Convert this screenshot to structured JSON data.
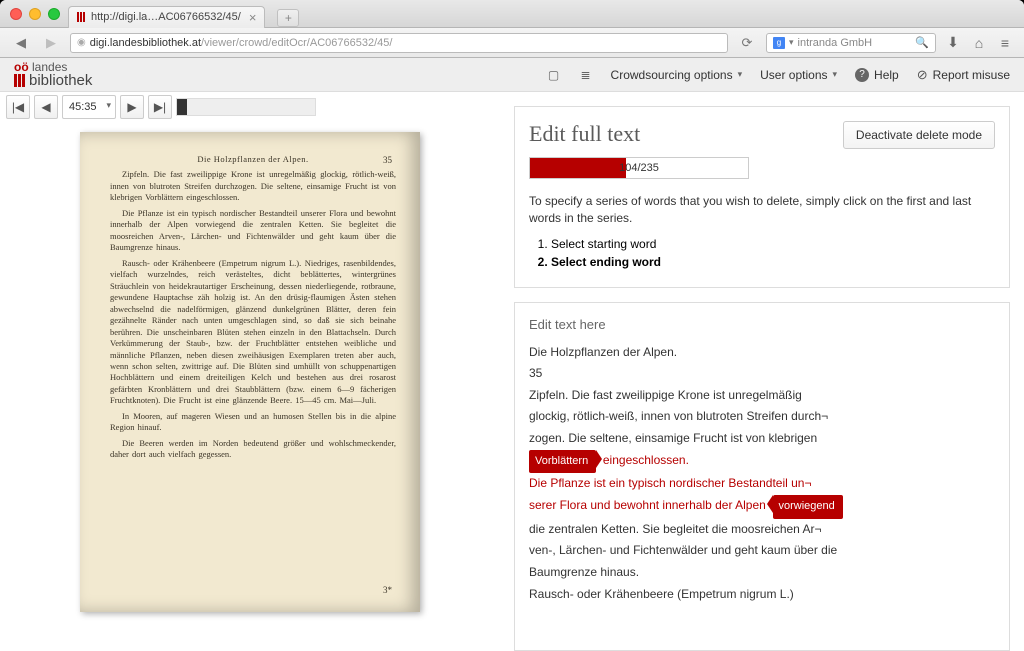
{
  "browser": {
    "tab_title": "http://digi.la…AC06766532/45/",
    "url_host": "digi.landesbibliothek.at",
    "url_path": "/viewer/crowd/editOcr/AC06766532/45/",
    "search_placeholder": "intranda GmbH"
  },
  "logo": {
    "top_prefix": "oö",
    "top": " landes",
    "bottom": "bibliothek"
  },
  "nav": {
    "crowdsourcing": "Crowdsourcing options",
    "user": "User options",
    "help": "Help",
    "report": "Report misuse"
  },
  "pager": {
    "current": "45:35"
  },
  "scan": {
    "running_head": "Die Holzpflanzen der Alpen.",
    "page_number": "35",
    "foot": "3*",
    "paragraphs": [
      "Zipfeln. Die fast zweilippige Krone ist unregelmäßig glockig, rötlich-weiß, innen von blutroten Streifen durchzogen. Die seltene, einsamige Frucht ist von klebrigen Vorblättern eingeschlossen.",
      "Die Pflanze ist ein typisch nordischer Bestandteil unserer Flora und bewohnt innerhalb der Alpen vorwiegend die zentralen Ketten. Sie begleitet die moosreichen Arven-, Lärchen- und Fichtenwälder und geht kaum über die Baumgrenze hinaus.",
      "Rausch- oder Krähenbeere (Empetrum nigrum L.). Niedriges, rasenbildendes, vielfach wurzelndes, reich verästeltes, dicht beblättertes, wintergrünes Sträuchlein von heidekrautartiger Erscheinung, dessen niederliegende, rotbraune, gewundene Hauptachse zäh holzig ist. An den drüsig-flaumigen Ästen stehen abwechselnd die nadelförmigen, glänzend dunkelgrünen Blätter, deren fein gezähnelte Ränder nach unten umgeschlagen sind, so daß sie sich beinahe berühren. Die unscheinbaren Blüten stehen einzeln in den Blattachseln. Durch Verkümmerung der Staub-, bzw. der Fruchtblätter entstehen weibliche und männliche Pflanzen, neben diesen zweihäusigen Exemplaren treten aber auch, wenn schon selten, zwittrige auf. Die Blüten sind umhüllt von schuppenartigen Hochblättern und einem dreiteiligen Kelch und bestehen aus drei rosarost gefärbten Kronblättern und drei Staubblättern (bzw. einem 6—9 fächerigen Fruchtknoten). Die Frucht ist eine glänzende Beere. 15—45 cm. Mai—Juli.",
      "In Mooren, auf mageren Wiesen und an humosen Stellen bis in die alpine Region hinauf.",
      "Die Beeren werden im Norden bedeutend größer und wohlschmeckender, daher dort auch vielfach gegessen."
    ]
  },
  "edit": {
    "title": "Edit full text",
    "progress_label": "104/235",
    "progress_pct": 44,
    "deactivate": "Deactivate delete mode",
    "instructions": "To specify a series of words that you wish to delete, simply click on the first and last words in the series.",
    "steps": [
      "Select starting word",
      "Select ending word"
    ]
  },
  "ocr": {
    "heading": "Edit text here",
    "lines": [
      "Die Holzpflanzen der Alpen.",
      "35",
      "Zipfeln. Die fast zweilippige Krone ist unregelmäßig",
      "glockig, rötlich-weiß, innen von blutroten Streifen durch¬",
      "zogen. Die seltene, einsamige Frucht ist von klebrigen"
    ],
    "tag_start": "Vorblättern",
    "after_start": "eingeschlossen.",
    "mid1": "Die Pflanze ist ein typisch nordischer Bestandteil un¬",
    "mid2_a": "serer Flora und bewohnt innerhalb der Alpen",
    "tag_end": "vorwiegend",
    "after": [
      "die zentralen Ketten. Sie begleitet die moosreichen Ar¬",
      "ven-, Lärchen- und Fichtenwälder und geht kaum über die",
      "Baumgrenze hinaus.",
      "Rausch- oder Krähenbeere (Empetrum nigrum L.)"
    ]
  }
}
